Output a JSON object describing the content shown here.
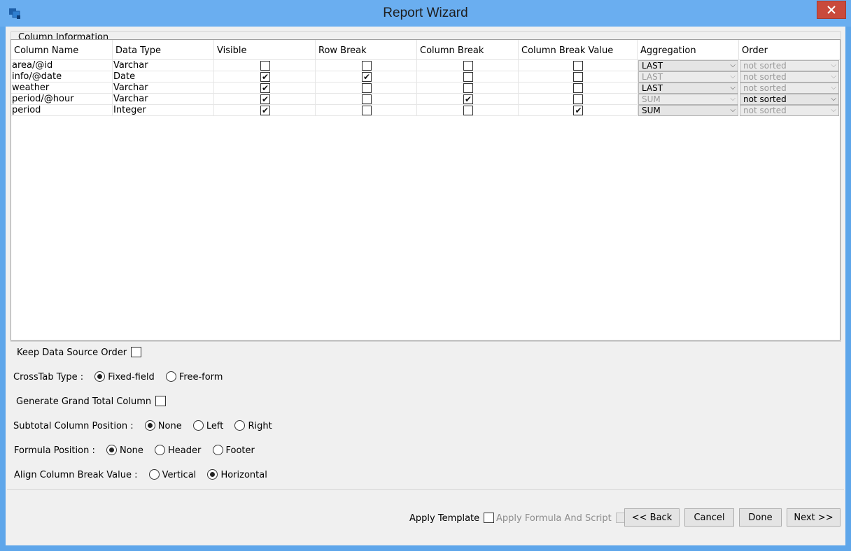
{
  "window": {
    "title": "Report Wizard"
  },
  "group": {
    "title": "Column Information"
  },
  "table": {
    "headers": [
      "Column Name",
      "Data Type",
      "Visible",
      "Row Break",
      "Column Break",
      "Column Break Value",
      "Aggregation",
      "Order"
    ],
    "rows": [
      {
        "name": "area/@id",
        "type": "Varchar",
        "visible": false,
        "row_break": false,
        "col_break": false,
        "col_break_value": false,
        "aggregation": "LAST",
        "agg_enabled": true,
        "order": "not sorted",
        "order_enabled": false
      },
      {
        "name": "info/@date",
        "type": "Date",
        "visible": true,
        "row_break": true,
        "col_break": false,
        "col_break_value": false,
        "aggregation": "LAST",
        "agg_enabled": false,
        "order": "not sorted",
        "order_enabled": false
      },
      {
        "name": "weather",
        "type": "Varchar",
        "visible": true,
        "row_break": false,
        "col_break": false,
        "col_break_value": false,
        "aggregation": "LAST",
        "agg_enabled": true,
        "order": "not sorted",
        "order_enabled": false
      },
      {
        "name": "period/@hour",
        "type": "Varchar",
        "visible": true,
        "row_break": false,
        "col_break": true,
        "col_break_value": false,
        "aggregation": "SUM",
        "agg_enabled": false,
        "order": "not sorted",
        "order_enabled": true
      },
      {
        "name": "period",
        "type": "Integer",
        "visible": true,
        "row_break": false,
        "col_break": false,
        "col_break_value": true,
        "aggregation": "SUM",
        "agg_enabled": true,
        "order": "not sorted",
        "order_enabled": false
      }
    ]
  },
  "options": {
    "keep_order_label": "Keep Data Source Order",
    "crosstab_label": "CrossTab Type :",
    "crosstab_fixed": "Fixed-field",
    "crosstab_free": "Free-form",
    "grand_total_label": "Generate Grand Total Column",
    "subtotal_label": "Subtotal Column Position :",
    "subtotal_none": "None",
    "subtotal_left": "Left",
    "subtotal_right": "Right",
    "formula_label": "Formula Position :",
    "formula_none": "None",
    "formula_header": "Header",
    "formula_footer": "Footer",
    "align_label": "Align Column Break Value :",
    "align_vertical": "Vertical",
    "align_horizontal": "Horizontal"
  },
  "footer": {
    "apply_template": "Apply Template",
    "apply_formula": "Apply Formula And Script",
    "back": "<< Back",
    "cancel": "Cancel",
    "done": "Done",
    "next": "Next >>"
  }
}
